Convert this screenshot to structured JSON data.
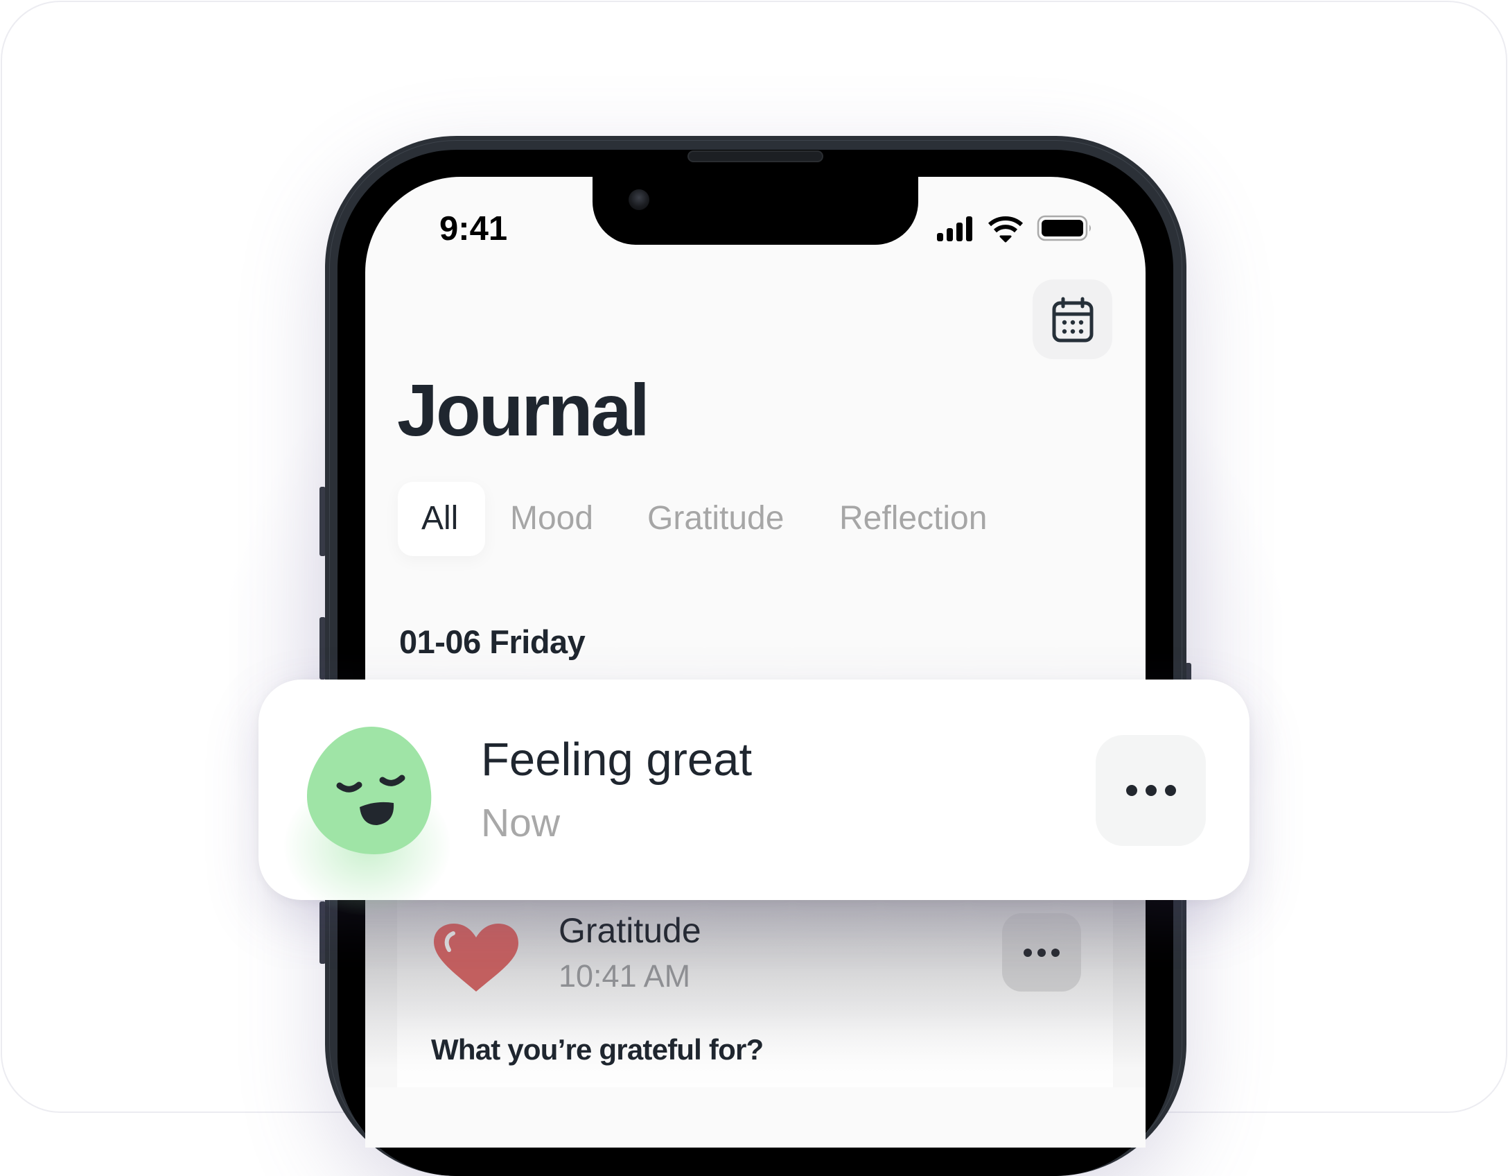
{
  "status_bar": {
    "time": "9:41",
    "icons": [
      "cellular-signal-icon",
      "wifi-icon",
      "battery-icon"
    ]
  },
  "header": {
    "title": "Journal",
    "calendar_button_icon": "calendar-icon"
  },
  "tabs": [
    {
      "label": "All",
      "active": true
    },
    {
      "label": "Mood",
      "active": false
    },
    {
      "label": "Gratitude",
      "active": false
    },
    {
      "label": "Reflection",
      "active": false
    }
  ],
  "section": {
    "date_heading": "01-06 Friday"
  },
  "entries": [
    {
      "type": "mood",
      "icon": "happy-blob-icon",
      "title": "Feeling great",
      "time": "Now",
      "more_icon": "more-horizontal-icon"
    },
    {
      "type": "gratitude",
      "icon": "heart-icon",
      "title": "Gratitude",
      "time": "10:41 AM",
      "prompt": "What you’re grateful for?",
      "more_icon": "more-horizontal-icon"
    }
  ],
  "colors": {
    "text_primary": "#1f262f",
    "text_muted": "#a6a6a6",
    "mood_green": "#9fe4a6",
    "heart_red": "#c25f5f",
    "screen_bg": "#fafafa"
  }
}
